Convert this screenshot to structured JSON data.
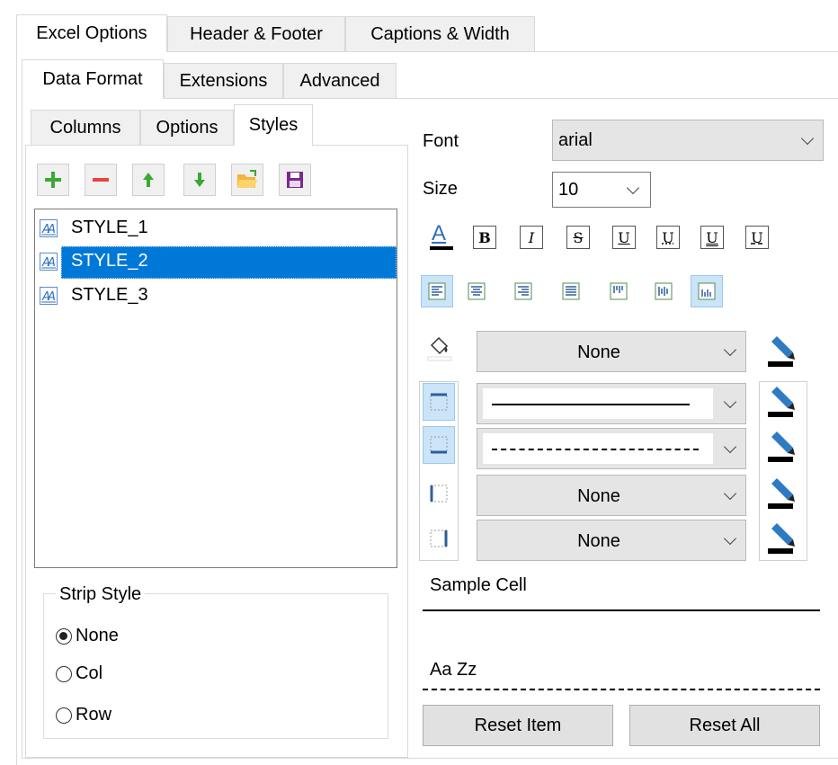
{
  "top_tabs": [
    "Excel Options",
    "Header & Footer",
    "Captions & Width"
  ],
  "sub_tabs": [
    "Data Format",
    "Extensions",
    "Advanced"
  ],
  "inner_tabs": [
    "Columns",
    "Options",
    "Styles"
  ],
  "toolbar": {
    "add_icon": "plus-icon",
    "remove_icon": "minus-icon",
    "up_icon": "arrow-up-icon",
    "down_icon": "arrow-down-icon",
    "open_icon": "folder-open-icon",
    "save_icon": "save-icon"
  },
  "styles_list": [
    "STYLE_1",
    "STYLE_2",
    "STYLE_3"
  ],
  "selected_style": "STYLE_2",
  "strip_style": {
    "title": "Strip Style",
    "options": [
      "None",
      "Col",
      "Row"
    ],
    "selected": "None"
  },
  "font": {
    "label": "Font",
    "value": "arial"
  },
  "size": {
    "label": "Size",
    "value": "10"
  },
  "font_color_glyph": "A",
  "format_buttons": [
    "B",
    "I",
    "S",
    "U",
    "U",
    "U",
    "U"
  ],
  "fill": {
    "value": "None"
  },
  "borders": {
    "top": {
      "value": "solid"
    },
    "bottom": {
      "value": "dashed"
    },
    "left": {
      "value": "None"
    },
    "right": {
      "value": "None"
    }
  },
  "sample": {
    "label": "Sample Cell",
    "text": "Aa Zz"
  },
  "buttons": {
    "reset_item": "Reset Item",
    "reset_all": "Reset All"
  },
  "colors": {
    "accent": "#0078d7",
    "selected_bg": "#0078d7",
    "toggle_bg": "#cce4f7"
  }
}
